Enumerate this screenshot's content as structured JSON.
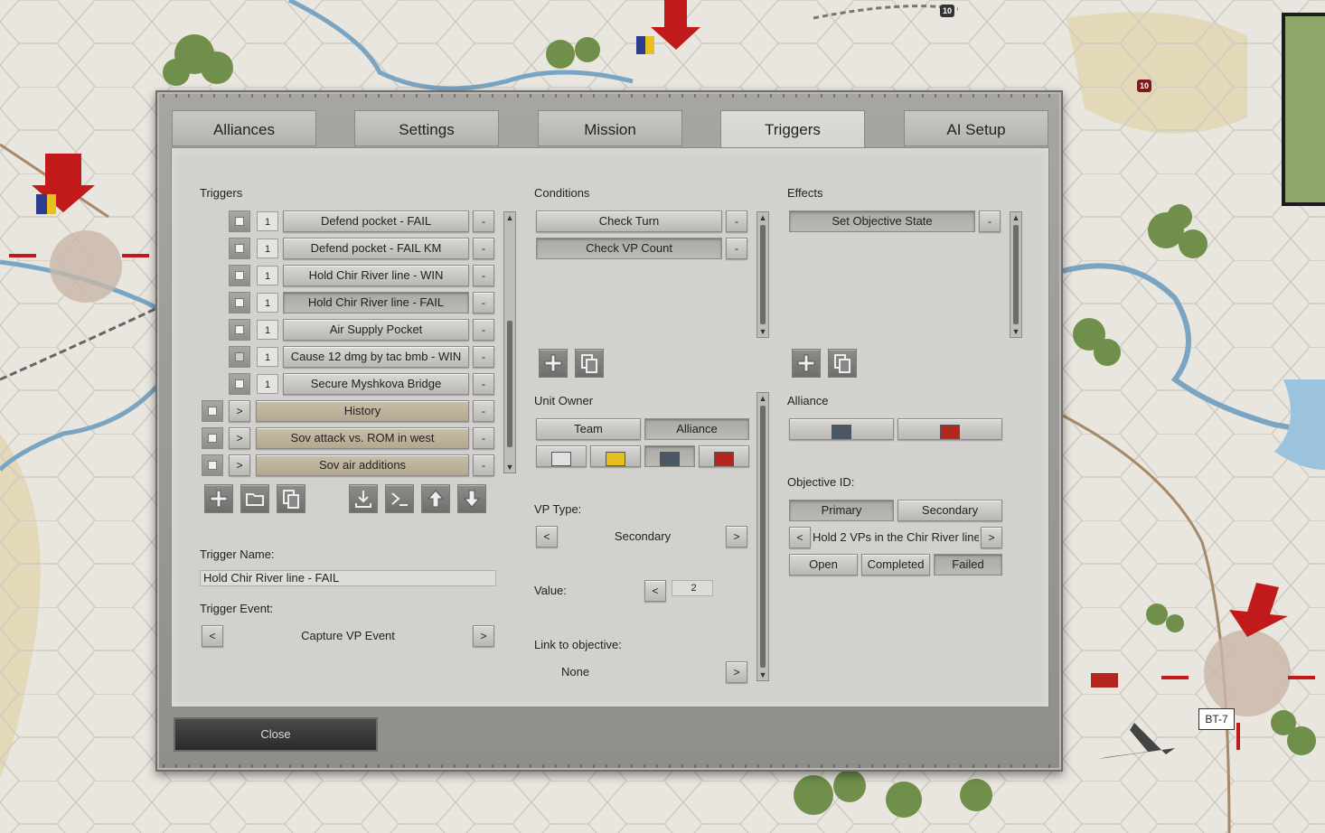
{
  "tabs": [
    "Alliances",
    "Settings",
    "Mission",
    "Triggers",
    "AI Setup"
  ],
  "active_tab": "Triggers",
  "triggers": {
    "heading": "Triggers",
    "items": [
      {
        "count": "1",
        "name": "Defend pocket - FAIL",
        "remove": "-"
      },
      {
        "count": "1",
        "name": "Defend pocket - FAIL KM",
        "remove": "-"
      },
      {
        "count": "1",
        "name": "Hold Chir River line  - WIN",
        "remove": "-"
      },
      {
        "count": "1",
        "name": "Hold Chir River line  - FAIL",
        "remove": "-"
      },
      {
        "count": "1",
        "name": "Air Supply Pocket",
        "remove": "-"
      },
      {
        "count": "1",
        "name": "Cause 12 dmg by tac bmb - WIN",
        "remove": "-"
      },
      {
        "count": "1",
        "name": "Secure Myshkova Bridge",
        "remove": "-"
      }
    ],
    "groups": [
      {
        "expand": ">",
        "name": "History",
        "remove": "-"
      },
      {
        "expand": ">",
        "name": "Sov attack vs. ROM in west",
        "remove": "-"
      },
      {
        "expand": ">",
        "name": "Sov air additions",
        "remove": "-"
      }
    ],
    "toolbar_icons": [
      "add-icon",
      "folder-icon",
      "copy-icon",
      "import-icon",
      "console-icon",
      "move-up-icon",
      "move-down-icon"
    ],
    "trigger_name_label": "Trigger Name:",
    "trigger_name_value": "Hold Chir River line  - FAIL",
    "trigger_event_label": "Trigger Event:",
    "trigger_event_value": "Capture VP Event",
    "prev": "<",
    "next": ">"
  },
  "conditions": {
    "heading": "Conditions",
    "items": [
      {
        "name": "Check Turn",
        "remove": "-"
      },
      {
        "name": "Check VP Count",
        "remove": "-"
      }
    ],
    "unit_owner_label": "Unit Owner",
    "team_label": "Team",
    "alliance_label": "Alliance",
    "colors": [
      "#e0e0e0",
      "#e6c021",
      "#4a5866",
      "#b3261e"
    ],
    "vp_type_label": "VP Type:",
    "vp_type_value": "Secondary",
    "value_label": "Value:",
    "value": "2",
    "link_label": "Link to objective:",
    "link_value": "None",
    "prev": "<",
    "next": ">"
  },
  "effects": {
    "heading": "Effects",
    "items": [
      {
        "name": "Set Objective State",
        "remove": "-"
      }
    ],
    "alliance_label": "Alliance",
    "alliance_colors": [
      "#4a5866",
      "#b3261e"
    ],
    "objective_id_label": "Objective ID:",
    "primary_label": "Primary",
    "secondary_label": "Secondary",
    "objective_value": "Hold 2 VPs in the Chir River line",
    "state_open": "Open",
    "state_completed": "Completed",
    "state_failed": "Failed",
    "prev": "<",
    "next": ">"
  },
  "close_label": "Close",
  "map": {
    "unit_label": "BT-7",
    "badge_top": "10",
    "badge_right": "10"
  }
}
